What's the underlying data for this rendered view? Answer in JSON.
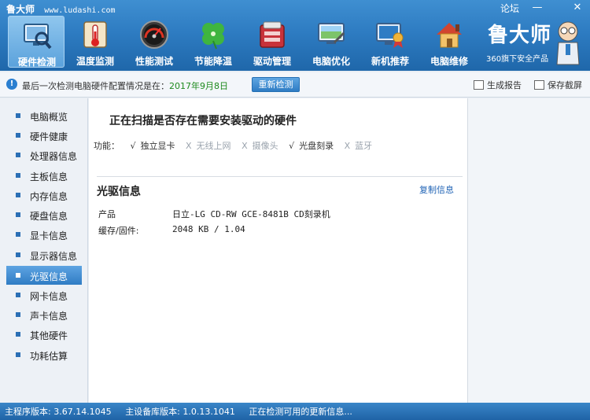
{
  "window": {
    "title": "鲁大师",
    "url": "www.ludashi.com",
    "forum": "论坛",
    "minimize": "—",
    "close": "✕"
  },
  "nav": [
    {
      "label": "硬件检测",
      "icon": "monitor-magnifier-icon",
      "active": true
    },
    {
      "label": "温度监测",
      "icon": "thermometer-icon",
      "active": false
    },
    {
      "label": "性能测试",
      "icon": "speedometer-icon",
      "active": false
    },
    {
      "label": "节能降温",
      "icon": "clover-icon",
      "active": false
    },
    {
      "label": "驱动管理",
      "icon": "driver-box-icon",
      "active": false
    },
    {
      "label": "电脑优化",
      "icon": "optimize-screen-icon",
      "active": false
    },
    {
      "label": "新机推荐",
      "icon": "award-monitor-icon",
      "active": false
    },
    {
      "label": "电脑维修",
      "icon": "house-wrench-icon",
      "active": false
    }
  ],
  "brand": {
    "name": "鲁大师",
    "subtitle": "360旗下安全产品"
  },
  "infobar": {
    "text": "最后一次检测电脑硬件配置情况是在：",
    "date": "2017年9月8日",
    "recheck": "重新检测",
    "report": "生成报告",
    "screenshot": "保存截屏"
  },
  "sidebar": [
    {
      "label": "电脑概览",
      "active": false
    },
    {
      "label": "硬件健康",
      "active": false
    },
    {
      "label": "处理器信息",
      "active": false
    },
    {
      "label": "主板信息",
      "active": false
    },
    {
      "label": "内存信息",
      "active": false
    },
    {
      "label": "硬盘信息",
      "active": false
    },
    {
      "label": "显卡信息",
      "active": false
    },
    {
      "label": "显示器信息",
      "active": false
    },
    {
      "label": "光驱信息",
      "active": true
    },
    {
      "label": "网卡信息",
      "active": false
    },
    {
      "label": "声卡信息",
      "active": false
    },
    {
      "label": "其他硬件",
      "active": false
    },
    {
      "label": "功耗估算",
      "active": false
    }
  ],
  "main": {
    "scan_title": "正在扫描是否存在需要安装驱动的硬件",
    "func_label": "功能：",
    "functions": [
      {
        "mark": "√",
        "label": "独立显卡",
        "enabled": true
      },
      {
        "mark": "X",
        "label": "无线上网",
        "enabled": false
      },
      {
        "mark": "X",
        "label": "摄像头",
        "enabled": false
      },
      {
        "mark": "√",
        "label": "光盘刻录",
        "enabled": true
      },
      {
        "mark": "X",
        "label": "蓝牙",
        "enabled": false
      }
    ],
    "section_title": "光驱信息",
    "copy": "复制信息",
    "rows": [
      {
        "label": "产品",
        "value": "日立-LG CD-RW GCE-8481B CD刻录机"
      },
      {
        "label": "缓存/固件:",
        "value": "2048 KB / 1.04"
      }
    ]
  },
  "statusbar": {
    "version": "主程序版本: 3.67.14.1045",
    "db_version": "主设备库版本: 1.0.13.1041",
    "message": "正在检测可用的更新信息..."
  }
}
